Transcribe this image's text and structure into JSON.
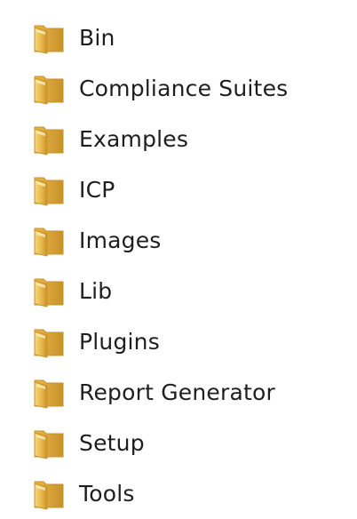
{
  "folders": [
    {
      "label": "Bin",
      "icon": "folder-icon"
    },
    {
      "label": "Compliance Suites",
      "icon": "folder-icon"
    },
    {
      "label": "Examples",
      "icon": "folder-icon"
    },
    {
      "label": "ICP",
      "icon": "folder-icon"
    },
    {
      "label": "Images",
      "icon": "folder-icon"
    },
    {
      "label": "Lib",
      "icon": "folder-icon"
    },
    {
      "label": "Plugins",
      "icon": "folder-icon"
    },
    {
      "label": "Report Generator",
      "icon": "folder-icon"
    },
    {
      "label": "Setup",
      "icon": "folder-icon"
    },
    {
      "label": "Tools",
      "icon": "folder-icon"
    }
  ],
  "colors": {
    "folder_light": "#f6d97e",
    "folder_mid": "#e9b94a",
    "folder_dark": "#c8912a",
    "text": "#1e1e1e",
    "background": "#ffffff"
  }
}
